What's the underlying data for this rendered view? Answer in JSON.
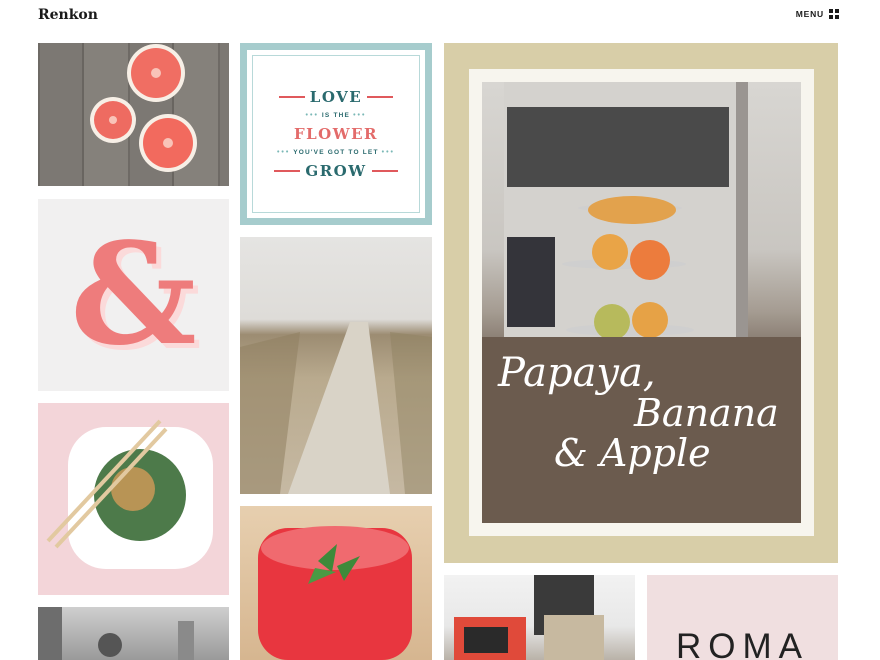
{
  "header": {
    "brand": "Renkon",
    "menu_label": "MENU"
  },
  "poster": {
    "line1": "LOVE",
    "line2": "IS THE",
    "line3": "FLOWER",
    "line4": "YOU'VE GOT TO LET",
    "line5": "GROW"
  },
  "ampersand": "&",
  "papaya": {
    "line1": "Papaya,",
    "line2": "Banana",
    "line3": "& Apple"
  },
  "roma": "ROMA",
  "colors": {
    "poster_teal": "#2a6a6e",
    "poster_red": "#e36b6a",
    "ampersand_pink": "#ee7c7c",
    "frame_tan": "#d8cea8",
    "roma_bg": "#f0dfe0"
  }
}
